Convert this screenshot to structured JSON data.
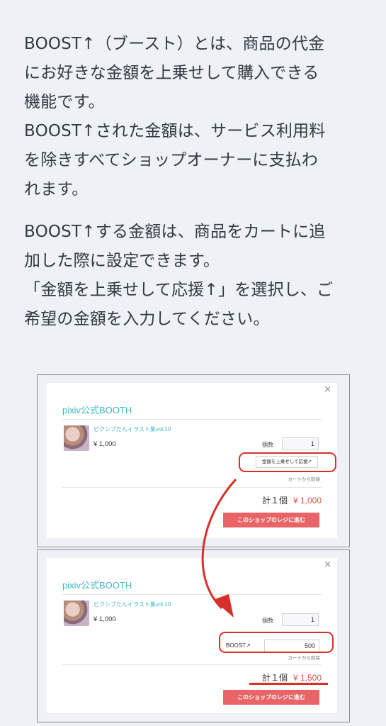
{
  "intro": {
    "p1_lines": [
      "BOOST↑（ブースト）とは、商品の代金",
      "にお好きな金額を上乗せして購入できる",
      "機能です。",
      "BOOST↑された金額は、サービス利用料",
      "を除きすべてショップオーナーに支払わ",
      "れます。"
    ],
    "p2_lines": [
      "BOOST↑する金額は、商品をカートに追",
      "加した際に設定できます。",
      "「金額を上乗せして応援↑」を選択し、ご",
      "希望の金額を入力してください。"
    ]
  },
  "close_symbol": "×",
  "card1": {
    "shop_name": "pixiv公式BOOTH",
    "item_title": "ピクシブたんイラスト集vol.10",
    "price": "¥ 1,000",
    "qty_label": "個数",
    "qty_value": "1",
    "boost_button_label": "金額を上乗せして応援↗",
    "remove_link": "カートから削除",
    "total_label": "計１個",
    "total_amount": "¥ 1,000",
    "checkout_label": "このショップのレジに進む"
  },
  "card2": {
    "shop_name": "pixiv公式BOOTH",
    "item_title": "ピクシブたんイラスト集vol.10",
    "price": "¥ 1,000",
    "qty_label": "個数",
    "qty_value": "1",
    "boost_label": "BOOST↗",
    "boost_value": "500",
    "remove_link": "カートから削除",
    "total_label": "計１個",
    "total_amount": "¥ 1,500",
    "checkout_label": "このショップのレジに進む"
  },
  "colors": {
    "background": "#eef1f5",
    "accent_teal": "#44b5c6",
    "checkout_red": "#e86466",
    "highlight_red": "#d6302a",
    "price_red": "#e0524d"
  }
}
